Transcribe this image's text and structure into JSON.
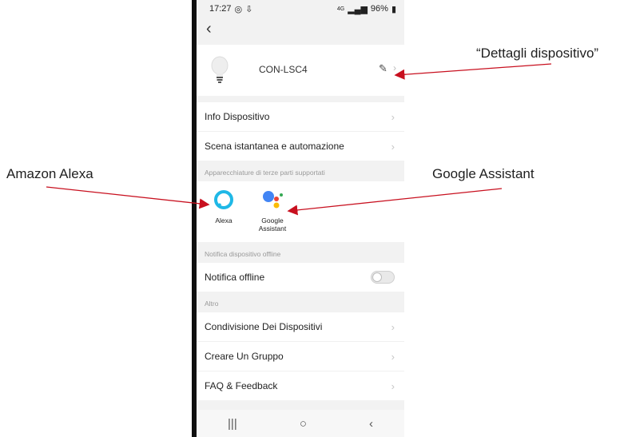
{
  "annotations": {
    "alexa": "Amazon Alexa",
    "google": "Google Assistant",
    "details": "“Dettagli dispositivo”"
  },
  "status_bar": {
    "time": "17:27",
    "network": "4G",
    "battery": "96%"
  },
  "device": {
    "name": "CON-LSC4"
  },
  "menu_1": [
    {
      "label": "Info Dispositivo"
    },
    {
      "label": "Scena istantanea e automazione"
    }
  ],
  "third_party": {
    "section_label": "Apparecchiature di terze parti supportati",
    "alexa_label": "Alexa",
    "google_label_line1": "Google",
    "google_label_line2": "Assistant"
  },
  "offline": {
    "section_label": "Notifica dispositivo offline",
    "toggle_label": "Notifica offline",
    "toggle_on": false
  },
  "other": {
    "section_label": "Altro",
    "items": [
      {
        "label": "Condivisione Dei Dispositivi"
      },
      {
        "label": "Creare Un Gruppo"
      },
      {
        "label": "FAQ & Feedback"
      }
    ]
  },
  "colors": {
    "arrow": "#c8101f",
    "alexa": "#1fb8e6",
    "google_blue": "#4285f4",
    "google_red": "#ea4335",
    "google_yellow": "#fbbc05",
    "google_green": "#34a853"
  }
}
